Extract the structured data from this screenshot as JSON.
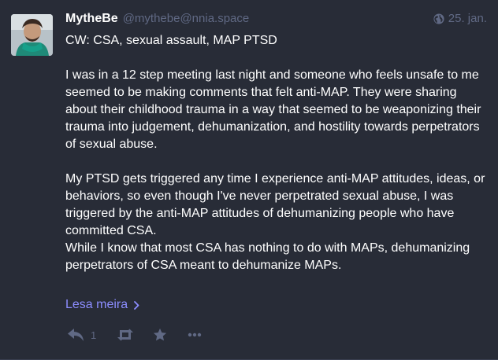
{
  "status": {
    "display_name": "MytheBe",
    "account": "@mythebe@nnia.space",
    "date": "25. jan.",
    "visibility_icon": "globe-icon",
    "paragraphs": [
      "CW: CSA, sexual assault, MAP PTSD",
      "I was in a 12 step meeting last night and someone who feels unsafe to me seemed to be making comments that felt anti-MAP. They were sharing about their childhood trauma in a way that seemed to be weaponizing their trauma into judgement, dehumanization, and hostility towards perpetrators of sexual abuse.",
      "My PTSD gets triggered any time I experience anti-MAP attitudes, ideas, or behaviors, so even though I've never perpetrated sexual abuse, I was triggered by the anti-MAP attitudes of dehumanizing people who have committed CSA.",
      "While I know that most CSA has nothing to do with MAPs, dehumanizing perpetrators of CSA meant to dehumanize MAPs."
    ],
    "read_more": "Lesa meira",
    "reply_count": "1",
    "icons": [
      "reply-icon",
      "boost-icon",
      "star-icon",
      "more-icon",
      "chevron-right-icon"
    ]
  },
  "colors": {
    "background": "#282c37",
    "text": "#ffffff",
    "muted": "#606984",
    "link": "#8c8dff"
  }
}
